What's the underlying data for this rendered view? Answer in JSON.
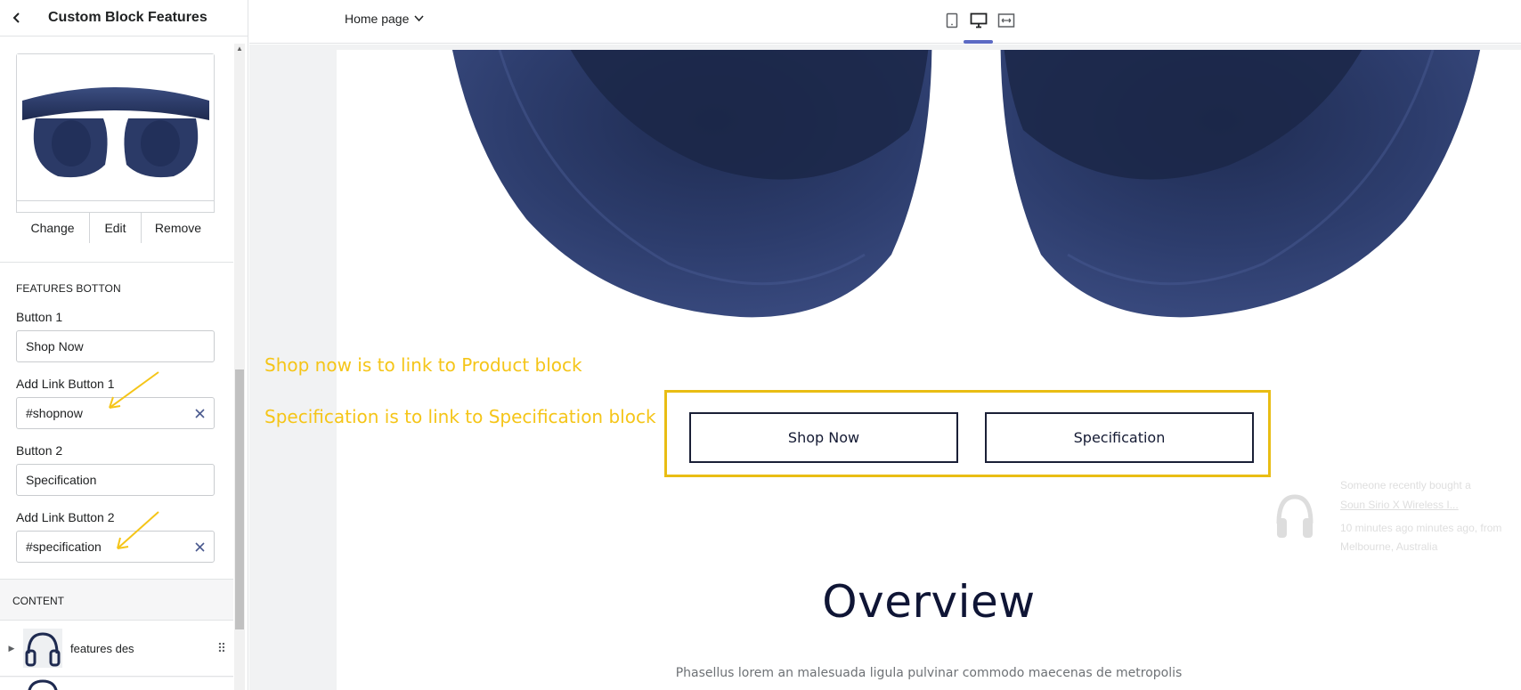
{
  "sidebar": {
    "title": "Custom Block Features",
    "image_actions": {
      "change": "Change",
      "edit": "Edit",
      "remove": "Remove"
    },
    "features_section": {
      "heading": "FEATURES BOTTON",
      "button1_label": "Button 1",
      "button1_value": "Shop Now",
      "link1_label": "Add Link Button 1",
      "link1_value": "#shopnow",
      "button2_label": "Button 2",
      "button2_value": "Specification",
      "link2_label": "Add Link Button 2",
      "link2_value": "#specification"
    },
    "content_section": {
      "heading": "CONTENT",
      "blocks": [
        {
          "label": "features des"
        }
      ]
    }
  },
  "topbar": {
    "page_selector": "Home page",
    "devices": [
      "mobile-icon",
      "desktop-icon",
      "fullwidth-icon"
    ],
    "active_device": "desktop"
  },
  "preview": {
    "annotations": {
      "line1": "Shop now is to link to Product block",
      "line2": "Specification is to link to Specification block"
    },
    "buttons": {
      "shop_now": "Shop Now",
      "specification": "Specification"
    },
    "overview_title": "Overview",
    "overview_text": "Phasellus lorem an malesuada ligula pulvinar commodo maecenas de metropolis",
    "toast": {
      "line1": "Someone recently bought a",
      "line2": "Soun Sirio X Wireless I...",
      "line3": "10 minutes ago minutes ago, from",
      "line4": "Melbourne, Australia"
    }
  },
  "colors": {
    "annotation": "#f5c518",
    "highlight_box": "#e9bd14",
    "active_tab": "#5c6ac4",
    "headphone_navy": "#2b3a67",
    "overview_text": "#0f1535"
  }
}
